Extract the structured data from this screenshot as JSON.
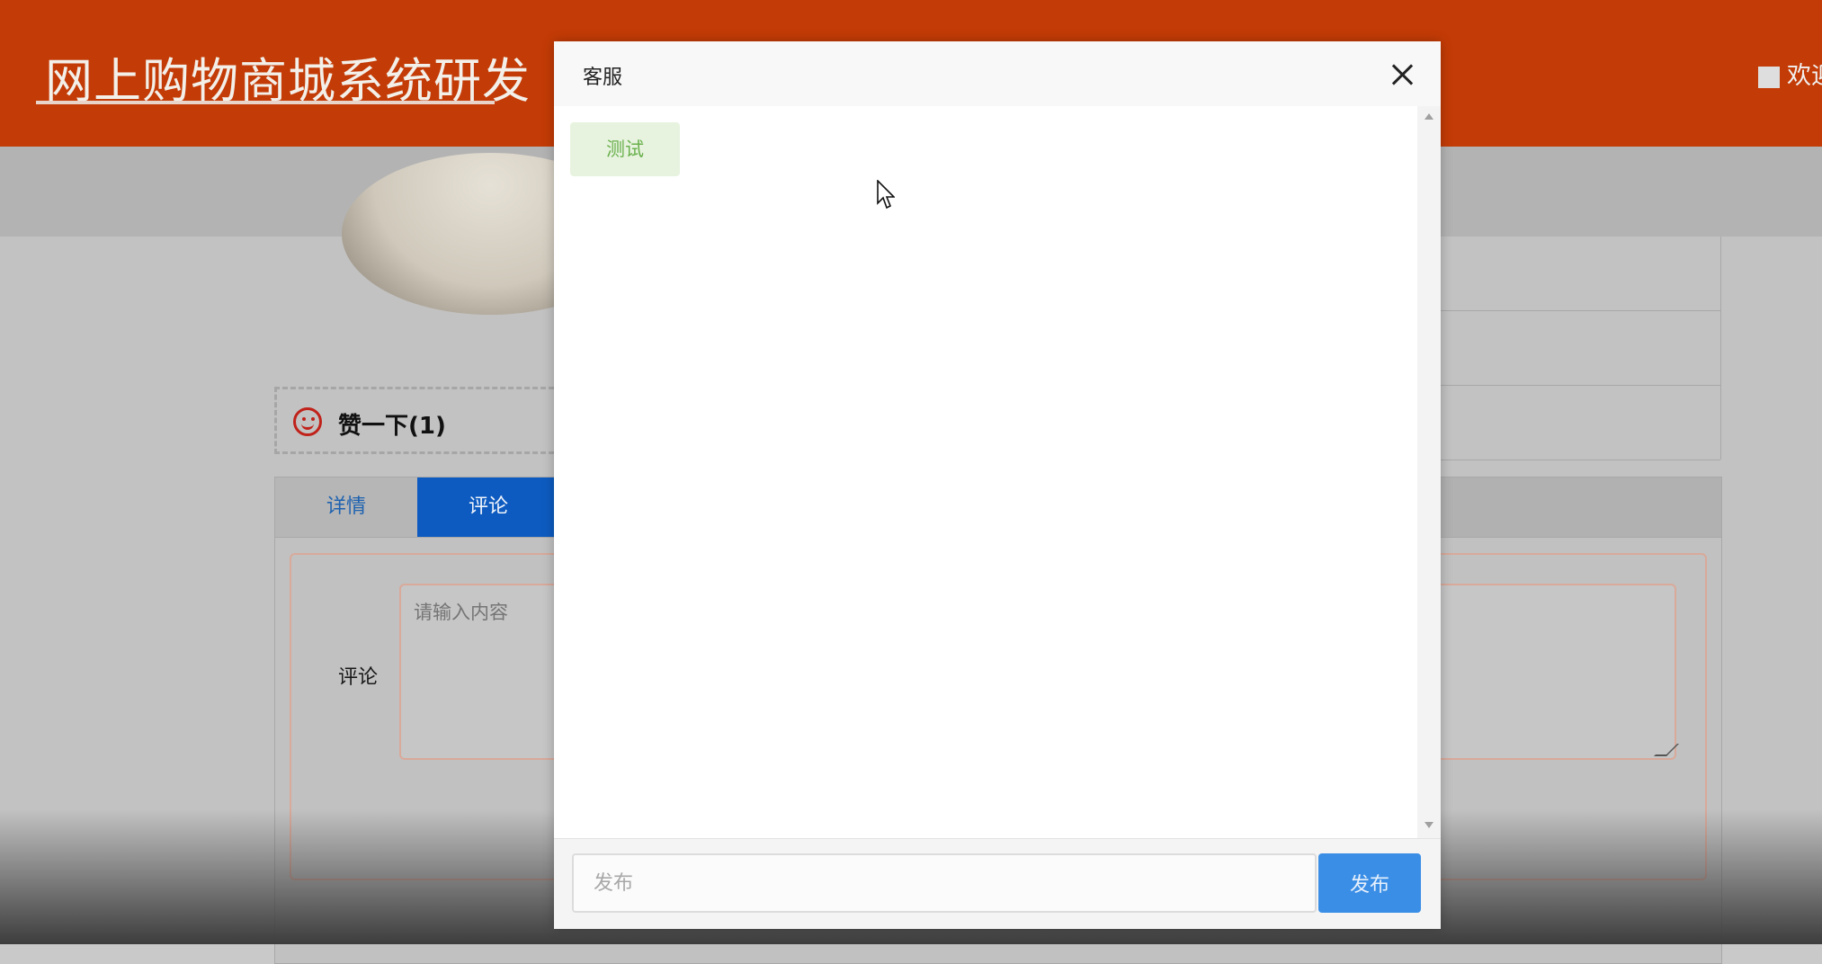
{
  "header": {
    "site_title": "网上购物商城系统研发",
    "welcome_text": "欢迎"
  },
  "like": {
    "label": "赞一下(1)"
  },
  "tabs": [
    {
      "label": "详情"
    },
    {
      "label": "评论"
    }
  ],
  "comment_form": {
    "label": "评论",
    "placeholder": "请输入内容"
  },
  "modal": {
    "title": "客服",
    "messages": [
      {
        "text": "测试"
      }
    ],
    "input_placeholder": "发布",
    "send_label": "发布"
  },
  "colors": {
    "header_bg": "#c33b06",
    "send_button": "#3a8ee6",
    "active_tab": "#0d5bc0",
    "message_bubble": "#e7f3df"
  }
}
